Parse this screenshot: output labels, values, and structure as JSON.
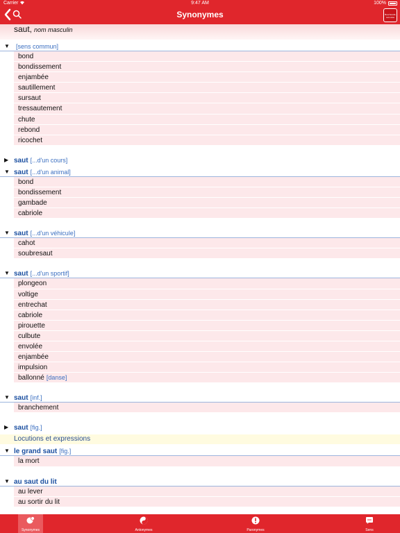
{
  "status": {
    "carrier": "Carrier",
    "time": "9:47 AM",
    "battery": "100%"
  },
  "nav": {
    "title": "Synonymes",
    "logo_text": "Bescherelle Larousse"
  },
  "entry": {
    "word": "saut,",
    "gram": "nom masculin"
  },
  "senses": [
    {
      "expanded": true,
      "keyword": "",
      "context": "[sens commun]",
      "items": [
        "bond",
        "bondissement",
        "enjambée",
        "sautillement",
        "sursaut",
        "tressautement",
        "chute",
        "rebond",
        "ricochet"
      ]
    },
    {
      "expanded": false,
      "keyword": "saut",
      "context": "[...d'un cours]",
      "items": []
    },
    {
      "expanded": true,
      "keyword": "saut",
      "context": "[...d'un animal]",
      "items": [
        "bond",
        "bondissement",
        "gambade",
        "cabriole"
      ]
    },
    {
      "expanded": true,
      "keyword": "saut",
      "context": "[...d'un véhicule]",
      "items": [
        "cahot",
        "soubresaut"
      ]
    },
    {
      "expanded": true,
      "keyword": "saut",
      "context": "[...d'un sportif]",
      "items": [
        "plongeon",
        "voltige",
        "entrechat",
        "cabriole",
        "pirouette",
        "culbute",
        "envolée",
        "enjambée",
        "impulsion",
        "ballonné"
      ],
      "last_tag": "[danse]"
    },
    {
      "expanded": true,
      "keyword": "saut",
      "context": "[inf.]",
      "items": [
        "branchement"
      ]
    },
    {
      "expanded": false,
      "keyword": "saut",
      "context": "[fig.]",
      "items": []
    }
  ],
  "locutions": {
    "label": "Locutions et expressions"
  },
  "expressions": [
    {
      "expanded": true,
      "keyword": "le grand saut",
      "context": "[fig.]",
      "items": [
        "la mort"
      ]
    },
    {
      "expanded": true,
      "keyword": "au saut du lit",
      "context": "",
      "items": [
        "au lever",
        "au sortir du lit"
      ]
    }
  ],
  "tabs": [
    {
      "label": "Synonymes",
      "icon": "synonyms-icon",
      "active": true
    },
    {
      "label": "Antonymes",
      "icon": "yin-yang-icon",
      "active": false
    },
    {
      "label": "Paronymes",
      "icon": "exclamation-icon",
      "active": false
    },
    {
      "label": "Sens",
      "icon": "speech-bubble-icon",
      "active": false
    }
  ],
  "colors": {
    "accent": "#e0262c",
    "item_bg": "#fde8ea",
    "keyword": "#1b4fa0",
    "context": "#3a6ec0"
  }
}
